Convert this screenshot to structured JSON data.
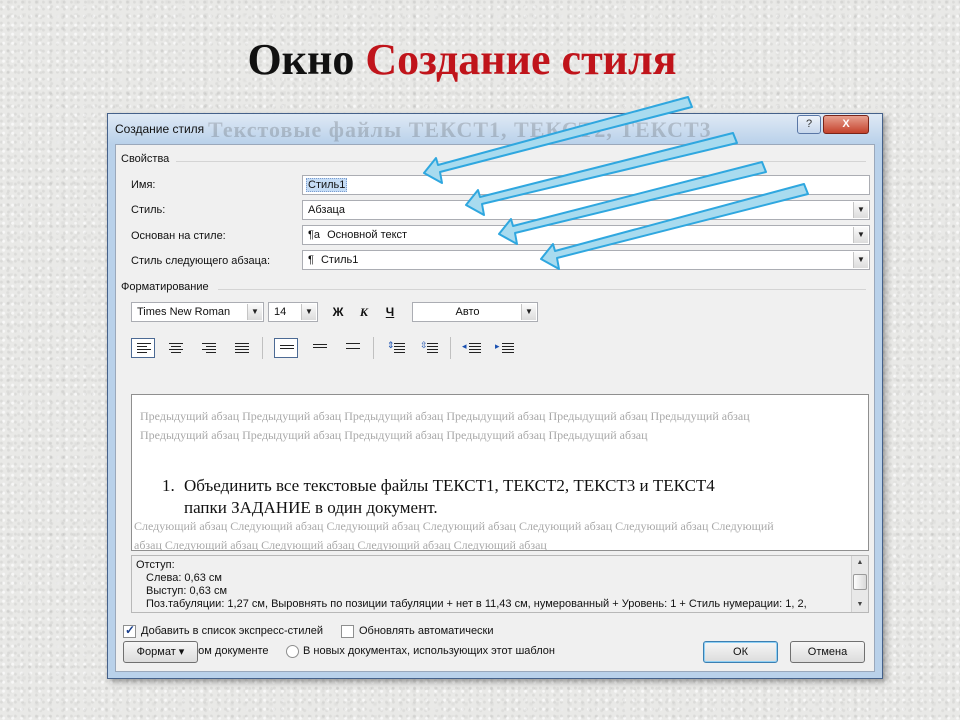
{
  "slide": {
    "title_part1": "Окно",
    "title_part2": "Создание стиля"
  },
  "dialog": {
    "title": "Создание стиля",
    "background_text": "Текстовые файлы ТЕКСТ1, ТЕКСТ2, ТЕКСТ3",
    "help_label": "?",
    "close_label": "X"
  },
  "properties": {
    "group_label": "Свойства",
    "name_label": "Имя:",
    "name_value": "Стиль1",
    "style_label": "Стиль:",
    "style_value": "Абзаца",
    "based_on_label": "Основан на стиле:",
    "based_on_icon": "¶a",
    "based_on_value": "Основной текст",
    "next_style_label": "Стиль следующего абзаца:",
    "next_style_icon": "¶",
    "next_style_value": "Стиль1"
  },
  "formatting": {
    "group_label": "Форматирование",
    "font": "Times New Roman",
    "size": "14",
    "bold_label": "Ж",
    "italic_label": "К",
    "underline_label": "Ч",
    "color": "Авто"
  },
  "preview": {
    "previous_text": "Предыдущий абзац Предыдущий абзац Предыдущий абзац Предыдущий абзац Предыдущий абзац Предыдущий абзац Предыдущий абзац Предыдущий абзац Предыдущий абзац Предыдущий абзац Предыдущий абзац",
    "list_number": "1.",
    "list_text": "Объединить все текстовые файлы ТЕКСТ1, ТЕКСТ2, ТЕКСТ3 и ТЕКСТ4    папки ЗАДАНИЕ в один документ.",
    "next_text": "Следующий абзац Следующий абзац Следующий абзац Следующий абзац Следующий абзац Следующий абзац Следующий абзац Следующий абзац Следующий абзац Следующий абзац Следующий абзац"
  },
  "description": {
    "line1": "Отступ:",
    "line2": "Слева:  0,63 см",
    "line3": "Выступ:  0,63 см",
    "line4": "Поз.табуляции:  1,27 см, Выровнять по позиции табуляции + нет в  11,43 см, нумерованный + Уровень:  1 + Стиль нумерации: 1, 2,"
  },
  "options": {
    "add_quick_styles": "Добавить в список экспресс-стилей",
    "auto_update": "Обновлять автоматически",
    "only_this_doc": "Только в этом документе",
    "new_docs": "В новых документах, использующих этот шаблон"
  },
  "buttons": {
    "format": "Формат ▾",
    "ok": "ОК",
    "cancel": "Отмена"
  },
  "colors": {
    "title_red": "#c0141b",
    "arrow_fill": "#a8dbef",
    "arrow_stroke": "#2fa7df"
  }
}
